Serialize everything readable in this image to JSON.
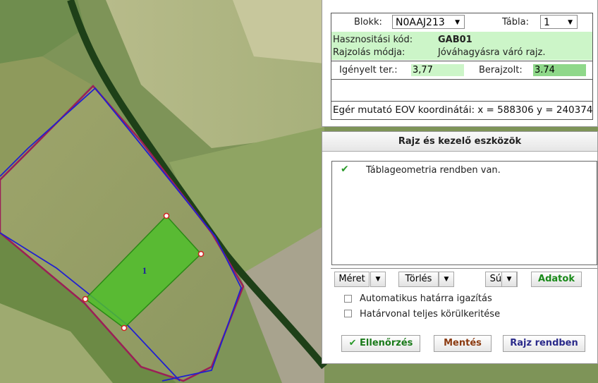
{
  "map": {
    "parcel_label": "1"
  },
  "info": {
    "blokk_label": "Blokk:",
    "blokk_value": "N0AAJ213",
    "tabla_label": "Tábla:",
    "tabla_value": "1",
    "hasznositasi_label": "Hasznositási kód:",
    "hasznositasi_value": "GAB01",
    "rajzolas_label": "Rajzolás módja:",
    "rajzolas_value": "Jóváhagyásra váró rajz.",
    "igenyelt_label": "Igényelt ter.:",
    "igenyelt_value": "3,77",
    "berajzolt_label": "Berajzolt:",
    "berajzolt_value": "3.74",
    "coord_text": "Egér mutató EOV koordinátái: x = 588306   y = 240374"
  },
  "tools": {
    "title": "Rajz és kezelő eszközök",
    "message_check": "✔",
    "message": "Táblageometria rendben van.",
    "meret_label": "Méret",
    "torles_label": "Törlés",
    "sugo_label": "Súgó",
    "adatok_label": "Adatok",
    "auto_label": "Automatikus határra igazítás",
    "hatarvonal_label": "Határvonal teljes körülkeritése",
    "ellenorzes_label": "Ellenőrzés",
    "mentes_label": "Mentés",
    "rajz_label": "Rajz rendben"
  },
  "colors": {
    "accent_green": "#1a8a1a",
    "mentes_brown": "#8b3a10",
    "rajz_blue": "#2a2a8a",
    "field_green": "#ccf5c8"
  }
}
